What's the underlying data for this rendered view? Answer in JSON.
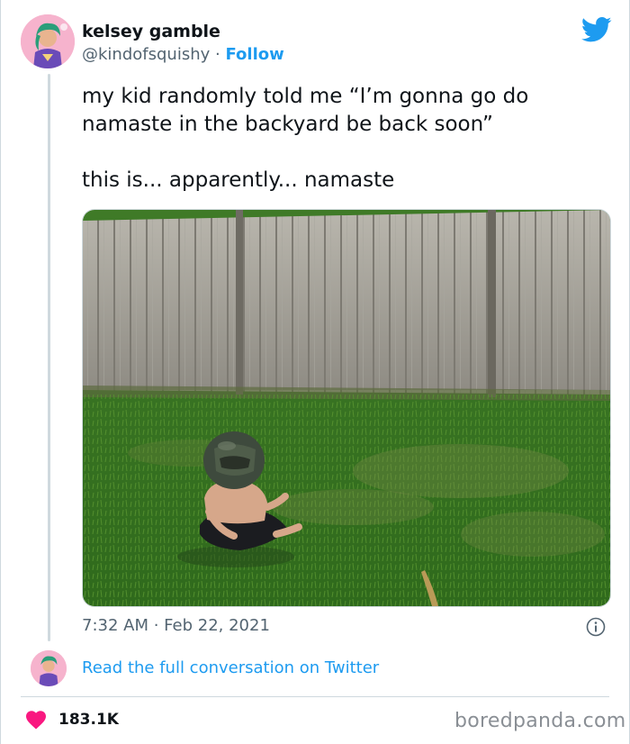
{
  "author": {
    "display_name": "kelsey gamble",
    "handle": "@kindofsquishy",
    "separator": "·",
    "follow_label": "Follow"
  },
  "tweet": {
    "lines": [
      "my kid randomly told me “I’m gonna go do namaste in the backyard be back soon”",
      "this is... apparently... namaste"
    ],
    "timestamp": "7:32 AM · Feb 22, 2021"
  },
  "conversation": {
    "link_label": "Read the full conversation on Twitter"
  },
  "stats": {
    "likes": "183.1K"
  },
  "watermark": "boredpanda.com",
  "colors": {
    "twitter_blue": "#1d9bf0",
    "heart": "#f91880",
    "text": "#0f1419",
    "muted": "#536471"
  },
  "icons": {
    "brand": "twitter-bird-icon",
    "info": "info-icon",
    "like": "heart-icon"
  }
}
